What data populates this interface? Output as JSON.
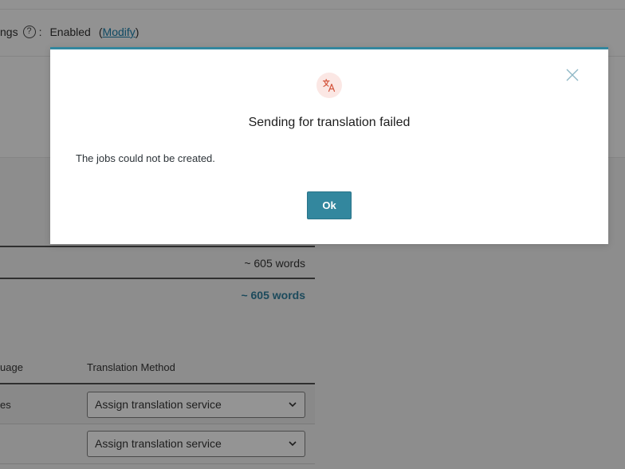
{
  "background": {
    "settings": {
      "label_fragment": "ngs",
      "help_symbol": "?",
      "colon": ":",
      "status": "Enabled",
      "paren_open": "(",
      "modify_link": "Modify",
      "paren_close": ")"
    },
    "word_count": "~ 605 words",
    "total_word_count": "~ 605 words",
    "table": {
      "headers": {
        "language": "uage",
        "method": "Translation Method"
      },
      "rows": [
        {
          "language": "es",
          "method": "Assign translation service"
        },
        {
          "language": "",
          "method": "Assign translation service"
        }
      ]
    }
  },
  "modal": {
    "icon": "translate-icon",
    "title": "Sending for translation failed",
    "message": "The jobs could not be created.",
    "ok_label": "Ok",
    "close_icon": "close-icon",
    "accent_color": "#33879e",
    "icon_color": "#d4563e"
  }
}
